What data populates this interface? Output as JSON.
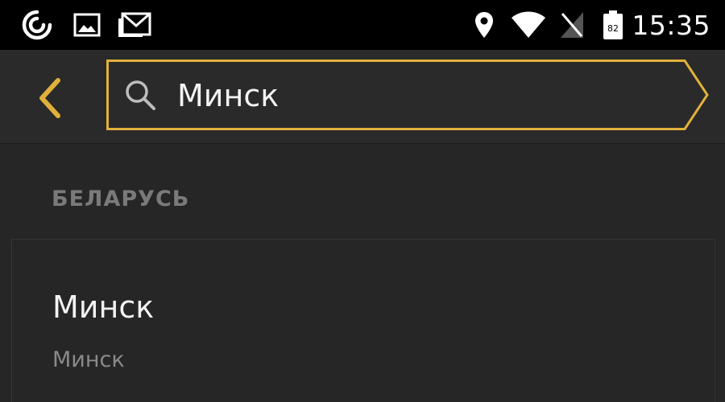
{
  "status_bar": {
    "time": "15:35",
    "battery_level": "82",
    "icons": [
      "pocket-casts-icon",
      "image-icon",
      "gmail-icon",
      "location-pin-icon",
      "wifi-icon",
      "no-sim-icon",
      "battery-icon"
    ]
  },
  "toolbar": {
    "back_icon": "chevron-left-icon",
    "search": {
      "icon": "search-icon",
      "value": "Минск"
    }
  },
  "results": {
    "section_title": "БЕЛАРУСЬ",
    "items": [
      {
        "title": "Минск",
        "subtitle": "Минск"
      }
    ]
  },
  "colors": {
    "accent": "#e0b13a",
    "background": "#262626",
    "status_bar": "#000000",
    "toolbar": "#2a2a2a"
  }
}
